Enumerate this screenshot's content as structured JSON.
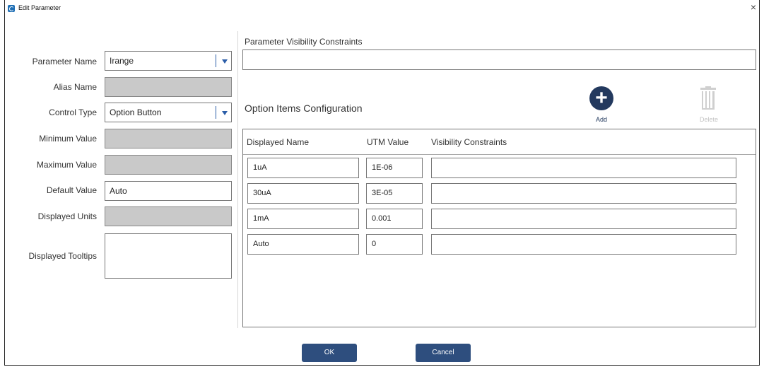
{
  "window": {
    "title": "Edit Parameter",
    "close_symbol": "×"
  },
  "form": {
    "parameter_name": {
      "label": "Parameter Name",
      "value": "Irange"
    },
    "alias_name": {
      "label": "Alias Name",
      "value": ""
    },
    "control_type": {
      "label": "Control Type",
      "value": "Option Button"
    },
    "minimum_value": {
      "label": "Minimum Value",
      "value": ""
    },
    "maximum_value": {
      "label": "Maximum Value",
      "value": ""
    },
    "default_value": {
      "label": "Default Value",
      "value": "Auto"
    },
    "displayed_units": {
      "label": "Displayed Units",
      "value": ""
    },
    "displayed_tooltips": {
      "label": "Displayed Tooltips",
      "value": ""
    }
  },
  "visibility": {
    "title": "Parameter Visibility Constraints",
    "value": ""
  },
  "options": {
    "title": "Option Items Configuration",
    "add_label": "Add",
    "add_symbol": "+",
    "delete_label": "Delete",
    "columns": [
      "Displayed Name",
      "UTM Value",
      "Visibility Constraints"
    ],
    "rows": [
      {
        "name": "1uA",
        "utm": "1E-06",
        "constraint": ""
      },
      {
        "name": "30uA",
        "utm": "3E-05",
        "constraint": ""
      },
      {
        "name": "1mA",
        "utm": "0.001",
        "constraint": ""
      },
      {
        "name": "Auto",
        "utm": "0",
        "constraint": ""
      }
    ]
  },
  "buttons": {
    "ok": "OK",
    "cancel": "Cancel"
  },
  "colors": {
    "accent": "#23395e",
    "button": "#2e4e7e",
    "disabled_field": "#c9c9c9",
    "combo_arrow": "#2b5da8"
  },
  "icons": {
    "app": "app-logo-icon",
    "close": "close-icon",
    "add": "plus-circle-icon",
    "delete": "trash-icon",
    "dropdown": "chevron-down-icon"
  }
}
